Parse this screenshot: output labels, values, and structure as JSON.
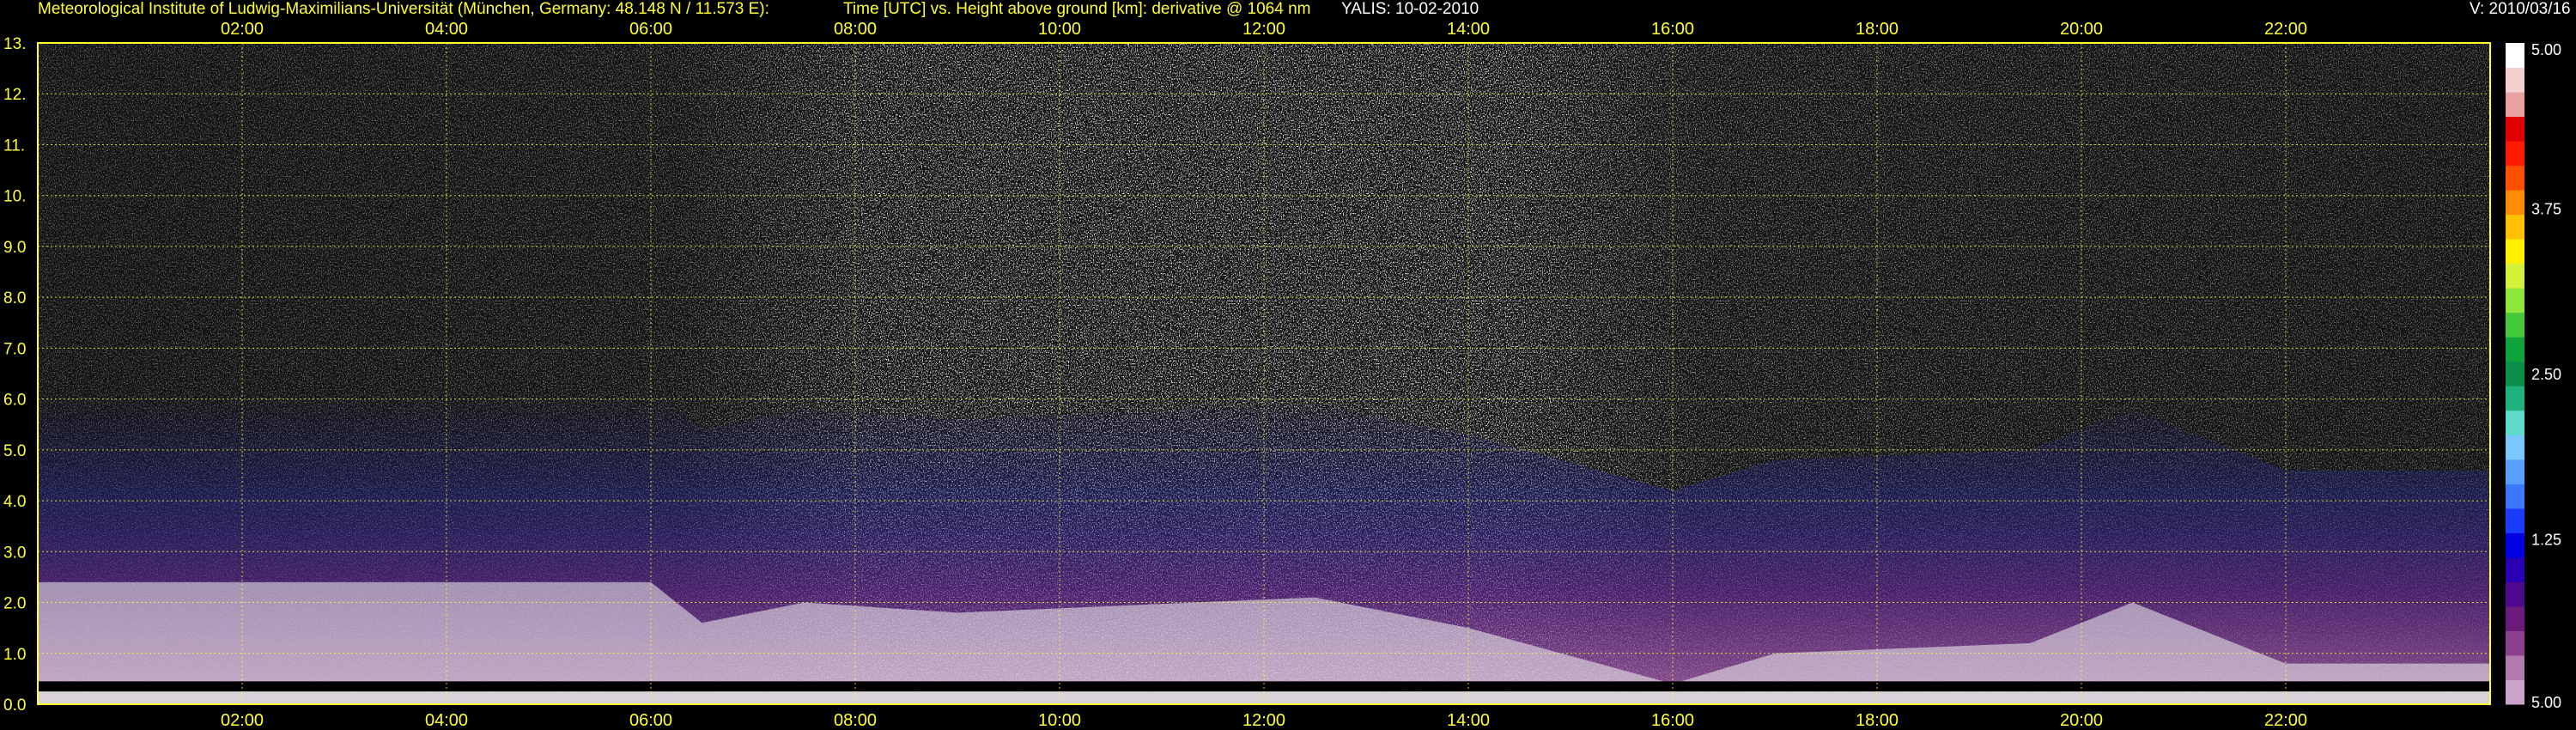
{
  "header": {
    "institute": "Meteorological Institute of Ludwig-Maximilians-Universität (München, Germany: 48.148 N / 11.573 E):",
    "description": "Time [UTC] vs. Height above ground [km]: derivative @ 1064 nm",
    "instrument_date": "YALIS: 10-02-2010",
    "version": "V: 2010/03/16"
  },
  "colors": {
    "background": "#000000",
    "grid": "#ffff33",
    "text_yellow": "#ffff33",
    "text_white": "#ffffff"
  },
  "chart_data": {
    "type": "heatmap",
    "title": "Time [UTC] vs. Height above ground [km]: derivative @ 1064 nm",
    "xlabel": "",
    "ylabel": "",
    "x_unit": "hours UTC",
    "y_unit": "km",
    "xlim": [
      0,
      24
    ],
    "ylim": [
      0,
      13
    ],
    "grid": true,
    "x_ticks": [
      {
        "value": 2,
        "label": "02:00"
      },
      {
        "value": 4,
        "label": "04:00"
      },
      {
        "value": 6,
        "label": "06:00"
      },
      {
        "value": 8,
        "label": "08:00"
      },
      {
        "value": 10,
        "label": "10:00"
      },
      {
        "value": 12,
        "label": "12:00"
      },
      {
        "value": 14,
        "label": "14:00"
      },
      {
        "value": 16,
        "label": "16:00"
      },
      {
        "value": 18,
        "label": "18:00"
      },
      {
        "value": 20,
        "label": "20:00"
      },
      {
        "value": 22,
        "label": "22:00"
      }
    ],
    "y_ticks": [
      {
        "value": 0,
        "label": "0.0"
      },
      {
        "value": 1,
        "label": "1.0"
      },
      {
        "value": 2,
        "label": "2.0"
      },
      {
        "value": 3,
        "label": "3.0"
      },
      {
        "value": 4,
        "label": "4.0"
      },
      {
        "value": 5,
        "label": "5.0"
      },
      {
        "value": 6,
        "label": "6.0"
      },
      {
        "value": 7,
        "label": "7.0"
      },
      {
        "value": 8,
        "label": "8.0"
      },
      {
        "value": 9,
        "label": "9.0"
      },
      {
        "value": 10,
        "label": "10."
      },
      {
        "value": 11,
        "label": "11."
      },
      {
        "value": 12,
        "label": "12."
      },
      {
        "value": 13,
        "label": "13."
      }
    ],
    "colorbar": {
      "labels": [
        {
          "value": 5.0,
          "label": "5.00"
        },
        {
          "value": 3.75,
          "label": "3.75"
        },
        {
          "value": 2.5,
          "label": "2.50"
        },
        {
          "value": 1.25,
          "label": "1.25"
        },
        {
          "value": 0.0,
          "label": "5.00"
        }
      ],
      "colors_bottom_to_top": [
        "#c9a4c9",
        "#b07cb0",
        "#8e3f8e",
        "#6a1a7a",
        "#4b0a8c",
        "#2a00b4",
        "#0000e0",
        "#1a3cff",
        "#3c78ff",
        "#5aa0ff",
        "#78c8ff",
        "#5fd9c8",
        "#1fb27f",
        "#0a8f4a",
        "#0fa33c",
        "#45c83a",
        "#8ee63a",
        "#d4f03a",
        "#fff000",
        "#ffc000",
        "#ff8c00",
        "#ff5000",
        "#ff1a00",
        "#e00000",
        "#e8a0a0",
        "#f4d0d0",
        "#ffffff"
      ]
    },
    "aerosol_layer_top_km": [
      [
        0.0,
        3.0
      ],
      [
        6.0,
        3.0
      ],
      [
        6.5,
        2.2
      ],
      [
        7.5,
        2.6
      ],
      [
        9.0,
        2.4
      ],
      [
        12.5,
        2.7
      ],
      [
        14.0,
        2.1
      ],
      [
        16.0,
        1.0
      ],
      [
        17.0,
        1.6
      ],
      [
        19.5,
        1.8
      ],
      [
        20.5,
        2.6
      ],
      [
        22.0,
        1.4
      ],
      [
        24.0,
        1.4
      ]
    ]
  }
}
